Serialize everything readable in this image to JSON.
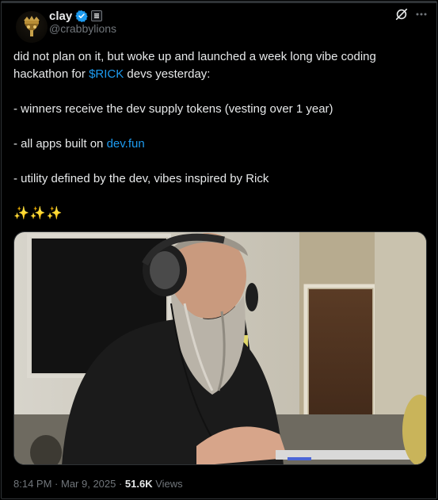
{
  "author": {
    "name": "clay",
    "handle": "@crabbylions",
    "verified": true
  },
  "icons": {
    "avatar": "crab-crown-avatar",
    "verified": "verified-badge-icon",
    "affiliation": "affiliate-badge-icon",
    "grok": "grok-icon",
    "more": "more-icon"
  },
  "tweet": {
    "line1_pre": "did not plan on it, but woke up and launched a week long vibe coding hackathon for ",
    "line1_link": "$RICK",
    "line1_post": " devs yesterday:",
    "bullet1": "- winners receive the dev supply tokens (vesting over 1 year)",
    "bullet2_pre": "- all apps built on ",
    "bullet2_link": "dev.fun",
    "bullet3": "- utility defined by the dev, vibes inspired by Rick",
    "sparkles": "✨✨✨"
  },
  "media": {
    "description_icon": "photo-man-with-headphones"
  },
  "meta": {
    "time": "8:14 PM",
    "dot1": " · ",
    "date": "Mar 9, 2025",
    "dot2": " · ",
    "views_count": "51.6K",
    "views_label": " Views"
  },
  "colors": {
    "background": "#000000",
    "text": "#e7e9ea",
    "muted": "#71767b",
    "link": "#1d9bf0",
    "verified": "#1d9bf0"
  }
}
